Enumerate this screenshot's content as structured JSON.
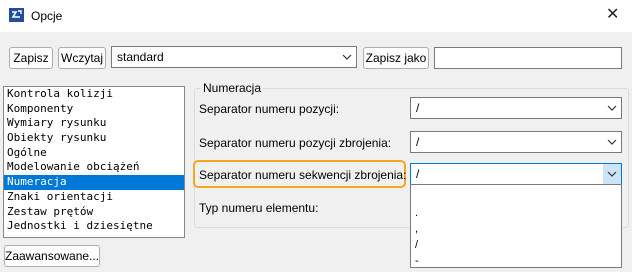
{
  "window": {
    "title": "Opcje"
  },
  "toolbar": {
    "save_label": "Zapisz",
    "load_label": "Wczytaj",
    "preset_value": "standard",
    "save_as_label": "Zapisz jako",
    "save_as_input": ""
  },
  "sidebar": {
    "items": [
      {
        "label": "Kontrola kolizji",
        "selected": false
      },
      {
        "label": "Komponenty",
        "selected": false
      },
      {
        "label": "Wymiary rysunku",
        "selected": false
      },
      {
        "label": "Obiekty rysunku",
        "selected": false
      },
      {
        "label": "Ogólne",
        "selected": false
      },
      {
        "label": "Modelowanie obciążeń",
        "selected": false
      },
      {
        "label": "Numeracja",
        "selected": true
      },
      {
        "label": "Znaki orientacji",
        "selected": false
      },
      {
        "label": "Zestaw prętów",
        "selected": false
      },
      {
        "label": "Jednostki i dziesiętne",
        "selected": false
      }
    ]
  },
  "advanced_label": "Zaawansowane...",
  "numbering": {
    "group_title": "Numeracja",
    "fields": [
      {
        "label": "Separator numeru pozycji:",
        "value": "/"
      },
      {
        "label": "Separator numeru pozycji zbrojenia:",
        "value": "/"
      },
      {
        "label": "Separator numeru sekwencji zbrojenia:",
        "value": "/"
      },
      {
        "label": "Typ numeru elementu:",
        "value": ""
      }
    ],
    "dropdown_options": [
      ".",
      ",",
      "/",
      "-"
    ]
  },
  "colors": {
    "highlight": "#f5a623",
    "selection": "#0078d7"
  }
}
